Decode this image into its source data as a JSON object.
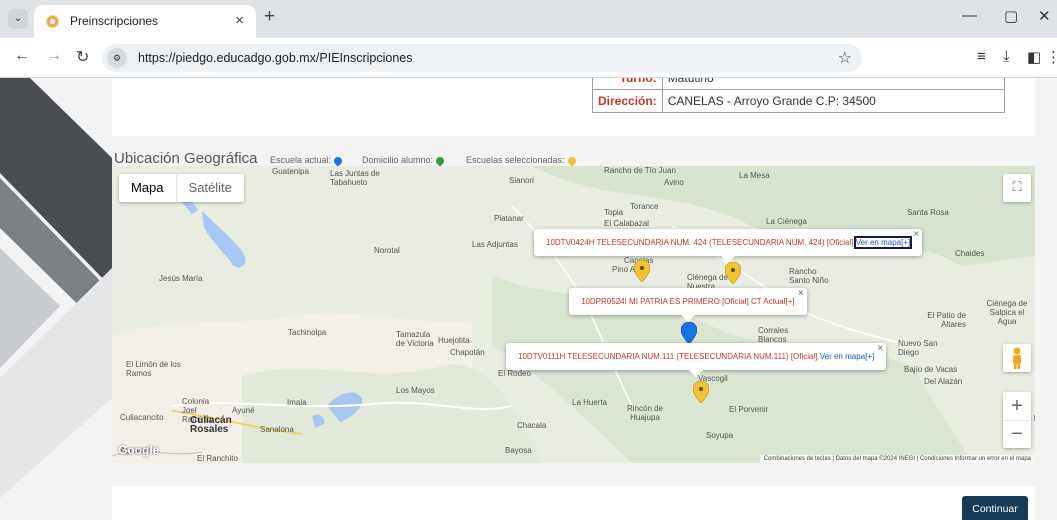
{
  "browser": {
    "tab_title": "Preinscripciones",
    "tab_close": "×",
    "new_tab": "+",
    "url": "https://piedgo.educadgo.gob.mx/PIEInscripciones",
    "controls": {
      "minimize": "—",
      "maximize": "▢",
      "close": "✕"
    }
  },
  "info_table": {
    "rows": [
      {
        "label": "Turno:",
        "value": "Matutino"
      },
      {
        "label": "Dirección:",
        "value": "CANELAS - Arroyo Grande C.P: 34500"
      }
    ]
  },
  "geo": {
    "title": "Ubicación Geográfica",
    "legend": {
      "current_school": "Escuela actual:",
      "student_home": "Domicilio alumno:",
      "selected_schools": "Escuelas seleccionadas:"
    },
    "colors": {
      "current": "#1a73e8",
      "home": "#2e9e3f",
      "selected": "#f1c232"
    }
  },
  "map": {
    "type_buttons": {
      "map": "Mapa",
      "satellite": "Satélite"
    },
    "places": [
      {
        "name": "Guatenipa"
      },
      {
        "name": "Las Juntas de Tabahueto"
      },
      {
        "name": "Sianori"
      },
      {
        "name": "Rancho de Tío Juan"
      },
      {
        "name": "Avino"
      },
      {
        "name": "La Mesa"
      },
      {
        "name": "Torance"
      },
      {
        "name": "Topia"
      },
      {
        "name": "El Calabazal"
      },
      {
        "name": "La Ciénega"
      },
      {
        "name": "Santa Rosa"
      },
      {
        "name": "Platanar"
      },
      {
        "name": "Las Adjuntas"
      },
      {
        "name": "Norotal"
      },
      {
        "name": "Canelas"
      },
      {
        "name": "Pino A"
      },
      {
        "name": "Ciénega de Nuestra"
      },
      {
        "name": "Rancho Santo Niño"
      },
      {
        "name": "Chaides"
      },
      {
        "name": "Jesús María"
      },
      {
        "name": "El Patio de Altares"
      },
      {
        "name": "Ciénega de Salpica el Agua"
      },
      {
        "name": "Tachinolpa"
      },
      {
        "name": "Tamazula de Victoria"
      },
      {
        "name": "Huejotita"
      },
      {
        "name": "Chapotán"
      },
      {
        "name": "Corrales Blancos"
      },
      {
        "name": "Nuevo San Diego"
      },
      {
        "name": "El Limón de los Ramos"
      },
      {
        "name": "El Rodeo"
      },
      {
        "name": "Vascogil"
      },
      {
        "name": "Bajío de Vacas"
      },
      {
        "name": "Del Alazán"
      },
      {
        "name": "Los Mayos"
      },
      {
        "name": "Colonia Joel Ramírez"
      },
      {
        "name": "Ayuné"
      },
      {
        "name": "Imala"
      },
      {
        "name": "La Huerta"
      },
      {
        "name": "Rincón de Huajupa"
      },
      {
        "name": "El Porvenir"
      },
      {
        "name": "Culiacancito"
      },
      {
        "name": "Chacala"
      },
      {
        "name": "Soyupa"
      },
      {
        "name": "Llano Bl"
      },
      {
        "name": "Sanalona"
      },
      {
        "name": "Aguaruto"
      },
      {
        "name": "Bayosa"
      },
      {
        "name": "El Ranchito"
      }
    ],
    "culiacan": "Culiacán Rosales",
    "info_windows": [
      {
        "text": "10DTV0424H TELESECUNDARIA NUM. 424 (TELESECUNDARIA NUM. 424) [Oficial]",
        "link": "Ver en mapa[+]"
      },
      {
        "text": "10DPR0524I MI PATRIA ES PRIMERO [Oficial] CT Actual[+]",
        "link": ""
      },
      {
        "text": "10DTV0111H TELESECUNDARIA NUM.111 (TELESECUNDARIA NUM.111) [Oficial]",
        "link": "Ver en mapa[+]"
      }
    ],
    "close_glyph": "×",
    "google": "Google",
    "attribution": "Combinaciones de teclas | Datos del mapa ©2024 INEGI | Condiciones   Informar un error en el mapa",
    "zoom_in": "+",
    "zoom_out": "−"
  },
  "actions": {
    "continue": "Continuar"
  }
}
